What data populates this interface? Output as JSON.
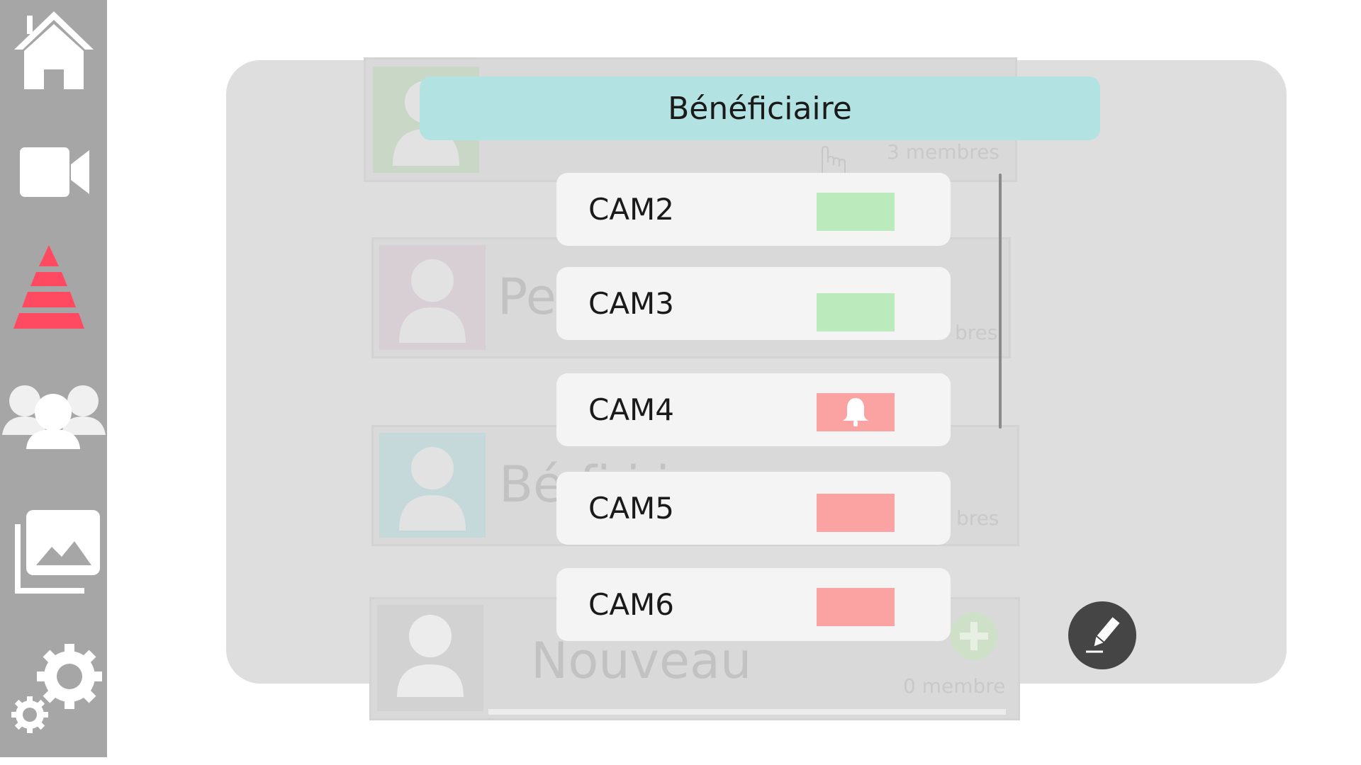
{
  "sidebar": {
    "items": [
      {
        "icon": "home-icon"
      },
      {
        "icon": "video-camera-icon"
      },
      {
        "icon": "pyramid-icon"
      },
      {
        "icon": "users-group-icon"
      },
      {
        "icon": "gallery-icon"
      },
      {
        "icon": "settings-gears-icon"
      }
    ]
  },
  "background_groups": [
    {
      "name": "",
      "count": "3 membres",
      "color": "#c9d7c7"
    },
    {
      "name": "Per",
      "count": "bres",
      "color": "#d8cfd4"
    },
    {
      "name": "Bé     fi i i",
      "count": "bres",
      "color": "#c5d8da"
    },
    {
      "name": "Nouveau",
      "count": "0 membre",
      "color": "#d2d2d2"
    }
  ],
  "dialog": {
    "title": "Bénéficiaire",
    "cameras": [
      {
        "label": "CAM2",
        "status": "ok",
        "color": "#bbebbd"
      },
      {
        "label": "CAM3",
        "status": "ok",
        "color": "#bbebbd"
      },
      {
        "label": "CAM4",
        "status": "alert",
        "color": "#fba2a2",
        "icon": "bell-icon"
      },
      {
        "label": "CAM5",
        "status": "off",
        "color": "#fba2a2"
      },
      {
        "label": "CAM6",
        "status": "off",
        "color": "#fba2a2"
      }
    ]
  },
  "edit_button": {
    "icon": "pencil-icon"
  }
}
